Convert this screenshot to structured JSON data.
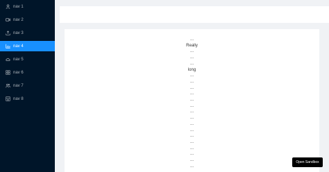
{
  "sidebar": {
    "items": [
      {
        "label": "nav 1",
        "icon": "user-icon",
        "active": false
      },
      {
        "label": "nav 2",
        "icon": "video-camera-icon",
        "active": false
      },
      {
        "label": "nav 3",
        "icon": "upload-icon",
        "active": false
      },
      {
        "label": "nav 4",
        "icon": "bar-chart-icon",
        "active": true
      },
      {
        "label": "nav 5",
        "icon": "cloud-icon",
        "active": false
      },
      {
        "label": "nav 6",
        "icon": "appstore-icon",
        "active": false
      },
      {
        "label": "nav 7",
        "icon": "team-icon",
        "active": false
      },
      {
        "label": "nav 8",
        "icon": "shop-icon",
        "active": false
      }
    ]
  },
  "content": {
    "lines": [
      "...",
      "Really",
      "...",
      "...",
      "...",
      "long",
      "...",
      "...",
      "...",
      "...",
      "...",
      "...",
      "...",
      "...",
      "...",
      "...",
      "...",
      "...",
      "...",
      "...",
      "...",
      "..."
    ]
  },
  "sandbox": {
    "label": "Open Sandbox"
  },
  "colors": {
    "sider": "#001529",
    "active": "#1890ff",
    "background": "#f0f2f5"
  }
}
